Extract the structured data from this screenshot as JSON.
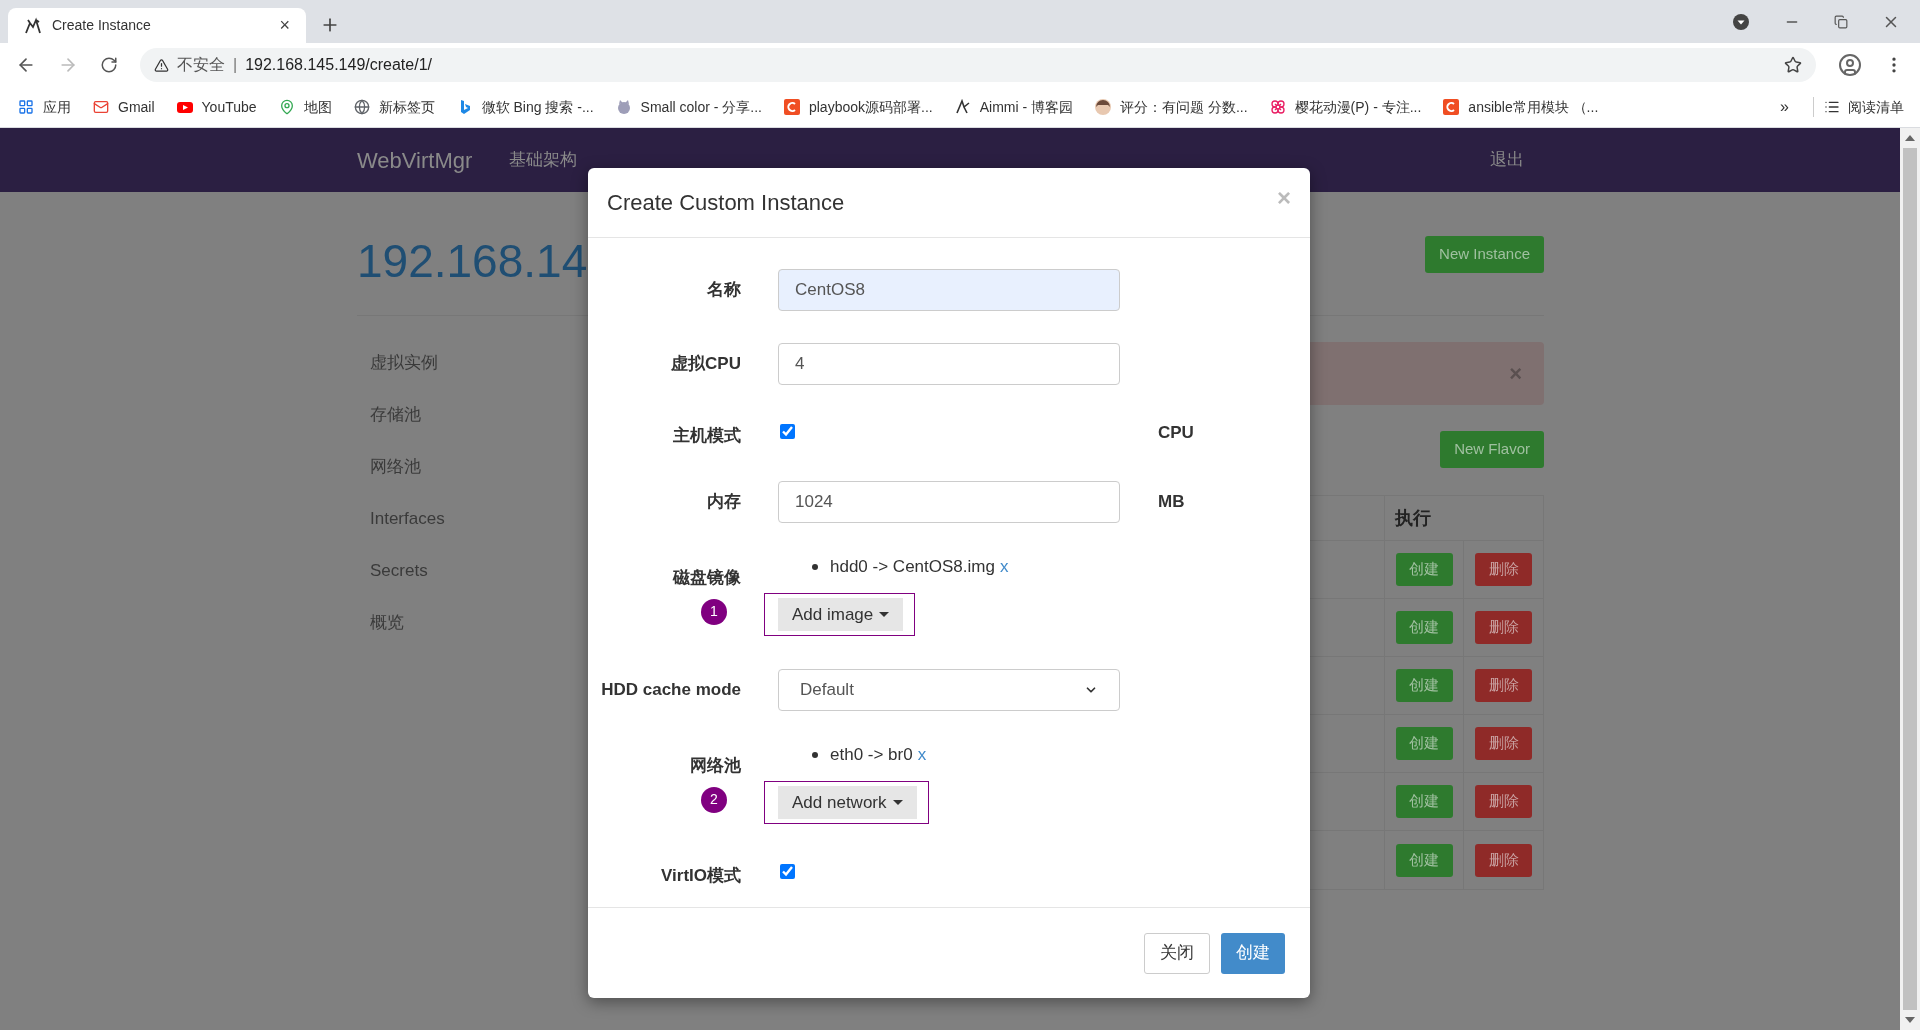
{
  "browser": {
    "tab": {
      "title": "Create Instance",
      "close": "×"
    },
    "address": {
      "security": "不安全",
      "separator": "|",
      "url": "192.168.145.149/create/1/"
    },
    "bookmarks": [
      {
        "label": "应用"
      },
      {
        "label": "Gmail"
      },
      {
        "label": "YouTube"
      },
      {
        "label": "地图"
      },
      {
        "label": "新标签页"
      },
      {
        "label": "微软 Bing 搜索 -..."
      },
      {
        "label": "Small color - 分享..."
      },
      {
        "label": "playbook源码部署..."
      },
      {
        "label": "Aimmi - 博客园"
      },
      {
        "label": "评分：有问题 分数..."
      },
      {
        "label": "樱花动漫(P) - 专注..."
      },
      {
        "label": "ansible常用模块 （..."
      }
    ],
    "bookmarks_more": "»",
    "reading_list": "阅读清单"
  },
  "navbar": {
    "brand": "WebVirtMgr",
    "links": [
      "基础架构"
    ],
    "logout": "退出"
  },
  "page": {
    "heading": "192.168.14",
    "new_instance": "New Instance",
    "sidebar": [
      "虚拟实例",
      "存储池",
      "网络池",
      "Interfaces",
      "Secrets",
      "概览"
    ],
    "alert": {
      "close": "×"
    },
    "new_flavor": "New Flavor",
    "table": {
      "columns": [
        "执行"
      ],
      "rows": [
        {
          "create": "创建",
          "delete": "删除"
        },
        {
          "create": "创建",
          "delete": "删除"
        },
        {
          "create": "创建",
          "delete": "删除"
        },
        {
          "create": "创建",
          "delete": "删除"
        },
        {
          "create": "创建",
          "delete": "删除"
        },
        {
          "create": "创建",
          "delete": "删除"
        }
      ]
    }
  },
  "modal": {
    "title": "Create Custom Instance",
    "close": "×",
    "fields": [
      {
        "kind": "text",
        "label": "名称",
        "value": "CentOS8",
        "highlighted": true
      },
      {
        "kind": "text",
        "label": "虚拟CPU",
        "value": "4",
        "highlighted": false
      },
      {
        "kind": "checkbox",
        "label": "主机模式",
        "checked": true,
        "suffix": "CPU"
      },
      {
        "kind": "text",
        "label": "内存",
        "value": "1024",
        "highlighted": false,
        "suffix": "MB"
      },
      {
        "kind": "list",
        "label": "磁盘镜像",
        "items": [
          {
            "text": "hdd0 -> CentOS8.img",
            "remove": "x"
          }
        ],
        "marker": "1",
        "button": "Add image"
      },
      {
        "kind": "select",
        "label": "HDD cache mode",
        "value": "Default"
      },
      {
        "kind": "list",
        "label": "网络池",
        "items": [
          {
            "text": "eth0 -> br0",
            "remove": "x"
          }
        ],
        "marker": "2",
        "button": "Add network"
      },
      {
        "kind": "checkbox",
        "label": "VirtIO模式",
        "checked": true
      }
    ],
    "buttons": {
      "close": "关闭",
      "create": "创建"
    }
  }
}
